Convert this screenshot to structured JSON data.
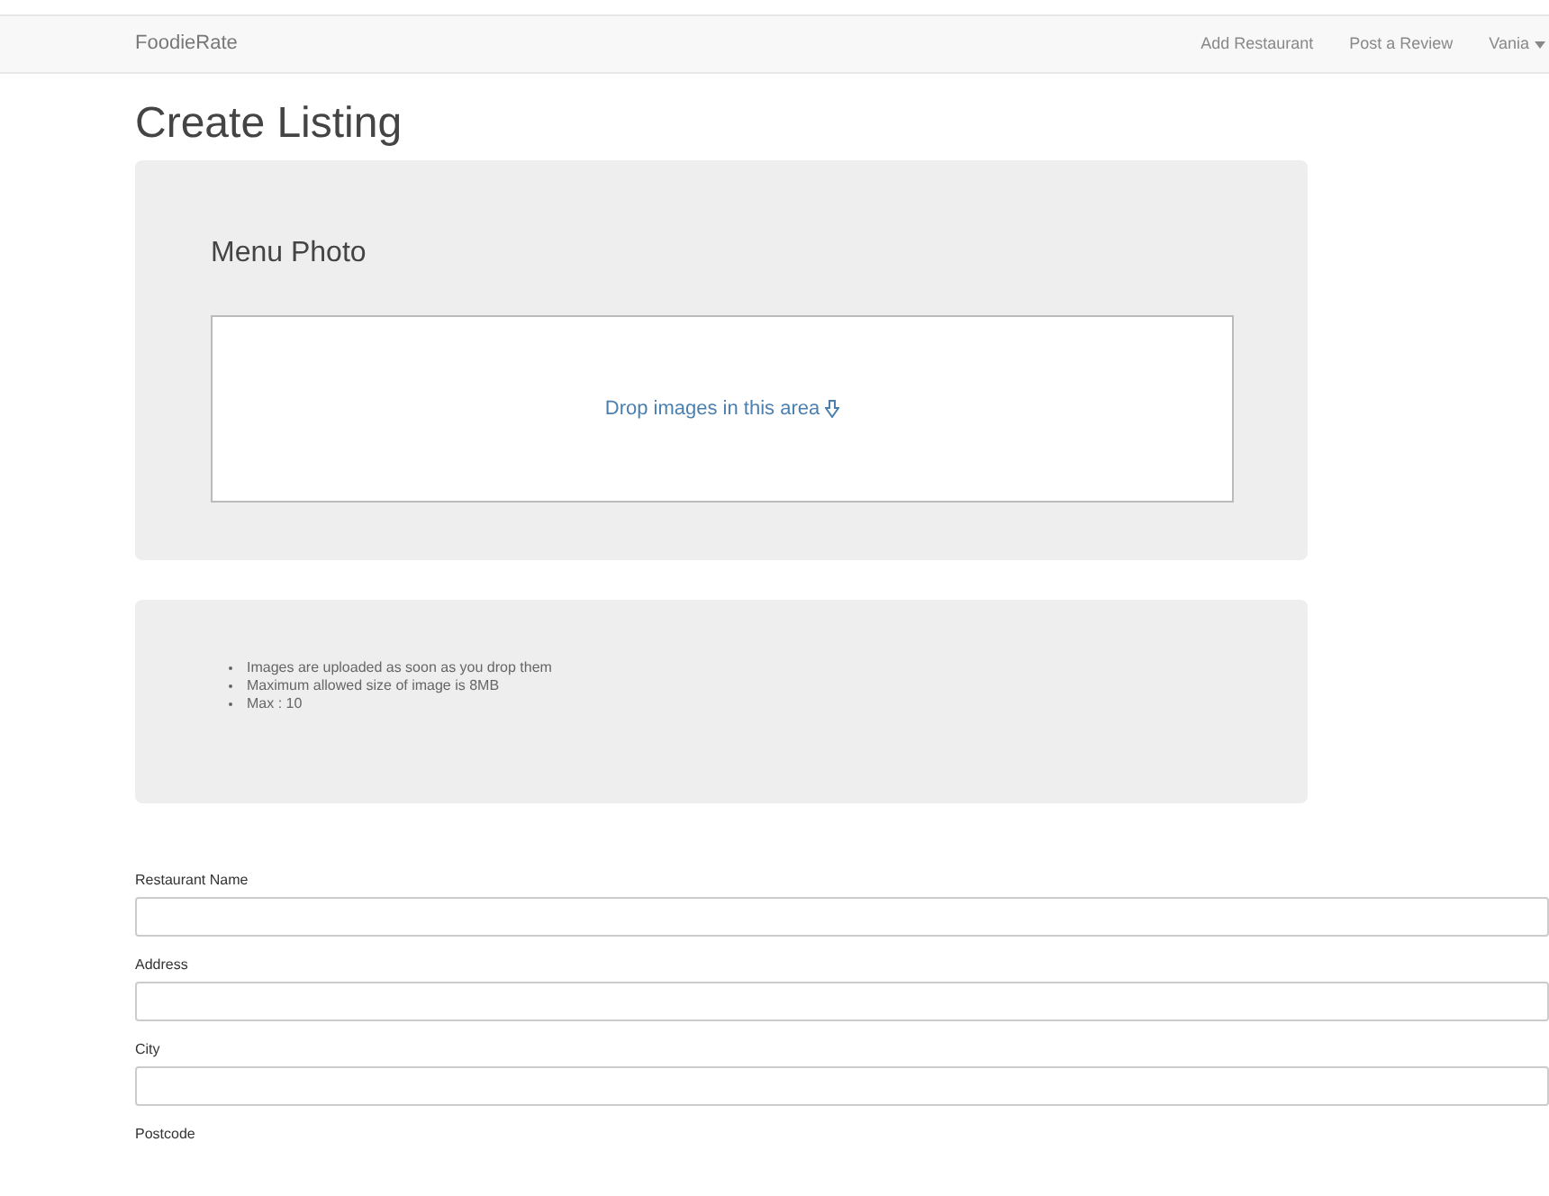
{
  "navbar": {
    "brand": "FoodieRate",
    "links": [
      "Add Restaurant",
      "Post a Review"
    ],
    "user_menu": "Vania"
  },
  "page_title": "Create Listing",
  "upload_panel": {
    "title": "Menu Photo",
    "dropzone_text": "Drop images in this area"
  },
  "notes": [
    "Images are uploaded as soon as you drop them",
    "Maximum allowed size of image is 8MB",
    "Max : 10"
  ],
  "fields": [
    {
      "label": "Restaurant Name"
    },
    {
      "label": "Address"
    },
    {
      "label": "City"
    },
    {
      "label": "Postcode"
    }
  ]
}
